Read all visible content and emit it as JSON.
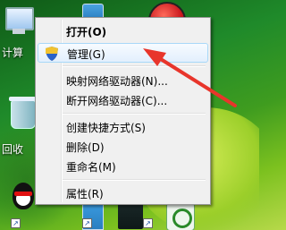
{
  "desktop": {
    "icons": [
      {
        "name": "computer",
        "label": "计算"
      },
      {
        "name": "recycle-bin",
        "label": "回收"
      }
    ]
  },
  "menu": {
    "items": [
      {
        "label": "打开(O)",
        "bold": true
      },
      {
        "label": "管理(G)",
        "highlighted": true
      },
      {
        "label": "映射网络驱动器(N)..."
      },
      {
        "label": "断开网络驱动器(C)..."
      },
      {
        "label": "创建快捷方式(S)"
      },
      {
        "label": "删除(D)"
      },
      {
        "label": "重命名(M)"
      },
      {
        "label": "属性(R)"
      }
    ]
  },
  "annotation": {
    "color": "#e8352b"
  }
}
